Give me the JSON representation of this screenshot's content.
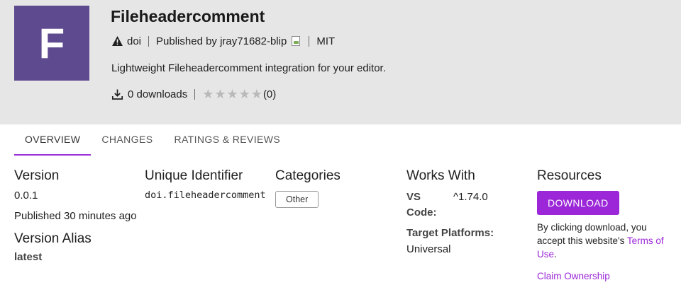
{
  "extension": {
    "logo_letter": "F",
    "name": "Fileheadercomment",
    "publisher_short": "doi",
    "published_by": "Published by jray71682-blip",
    "license": "MIT",
    "description": "Lightweight Fileheadercomment integration for your editor.",
    "downloads": "0 downloads",
    "rating_count": "(0)",
    "rating_value": 0,
    "rating_max": 5
  },
  "tabs": [
    {
      "label": "OVERVIEW",
      "active": true
    },
    {
      "label": "CHANGES",
      "active": false
    },
    {
      "label": "RATINGS & REVIEWS",
      "active": false
    }
  ],
  "version": {
    "heading": "Version",
    "value": "0.0.1",
    "published": "Published 30 minutes ago",
    "alias_heading": "Version Alias",
    "alias_value": "latest"
  },
  "identifier": {
    "heading": "Unique Identifier",
    "value": "doi.fileheadercomment"
  },
  "categories": {
    "heading": "Categories",
    "items": [
      "Other"
    ]
  },
  "works_with": {
    "heading": "Works With",
    "vs_label_1": "VS",
    "vs_label_2": "Code:",
    "vs_value": "^1.74.0",
    "platforms_label": "Target Platforms:",
    "platforms_value": "Universal"
  },
  "resources": {
    "heading": "Resources",
    "download_label": "DOWNLOAD",
    "accept_text": "By clicking download, you accept this website's",
    "terms_link": "Terms of Use",
    "accept_end": ".",
    "claim_label": "Claim Ownership"
  },
  "colors": {
    "accent": "#9b27d8",
    "logo_bg": "#5e4a8e",
    "header_bg": "#e6e6e6"
  }
}
